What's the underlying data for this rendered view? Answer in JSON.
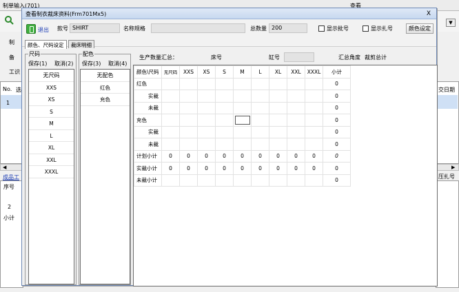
{
  "background": {
    "title": "制单输入(701)",
    "center_title": "查看",
    "left_labels": [
      "制",
      "备",
      "工识"
    ],
    "grid_col_no": "No.",
    "grid_col_partial": "选",
    "row_no": "1",
    "bottom_tab": "成品工",
    "bottom_col": "序号",
    "bottom_row": "2",
    "subtotal": "小计",
    "right_col_date": "交日期",
    "right_col_ticket": "压扎号"
  },
  "dialog": {
    "title": "查看制衣裁床资料(Frm701Mx5)",
    "close_label": "X",
    "toolbar": {
      "exit_label": "退出",
      "style_label": "款号",
      "style_value": "SHIRT",
      "name_label": "名称规格",
      "name_value": "",
      "total_label": "总数量",
      "total_value": "200",
      "show_batch_label": "显示批号",
      "show_ticket_label": "显示扎号",
      "color_settings_label": "颜色设定"
    },
    "tabs": [
      "颜色、尺码设定",
      "裁床明细"
    ],
    "size_panel": {
      "title": "尺码",
      "save_label": "保存(1)",
      "cancel_label": "取消(2)",
      "items": [
        "无尺码",
        "XXS",
        "XS",
        "S",
        "M",
        "L",
        "XL",
        "XXL",
        "XXXL"
      ]
    },
    "color_panel": {
      "title": "配色",
      "save_label": "保存(3)",
      "cancel_label": "取消(4)",
      "items": [
        "无配色",
        "红色",
        "充色"
      ]
    },
    "summary": {
      "production_label": "生产数量汇总：",
      "seq_label": "床号",
      "cylinder_label": "缸号",
      "cylinder_value": "",
      "angle_label": "汇总角度",
      "angle_value": "裁剪总计"
    },
    "matrix": {
      "corner": "颜色\\尺码",
      "columns": [
        "无尺码",
        "XXS",
        "XS",
        "S",
        "M",
        "L",
        "XL",
        "XXL",
        "XXXL"
      ],
      "total_col": "小计",
      "rows": [
        {
          "label": "红色",
          "indent": false,
          "values": [
            "",
            "",
            "",
            "",
            "",
            "",
            "",
            "",
            ""
          ],
          "total": "0"
        },
        {
          "label": "实裁",
          "indent": true,
          "values": [
            "",
            "",
            "",
            "",
            "",
            "",
            "",
            "",
            ""
          ],
          "total": "0"
        },
        {
          "label": "未裁",
          "indent": true,
          "values": [
            "",
            "",
            "",
            "",
            "",
            "",
            "",
            "",
            ""
          ],
          "total": "0"
        },
        {
          "label": "充色",
          "indent": false,
          "values": [
            "",
            "",
            "",
            "",
            "",
            "",
            "",
            "",
            ""
          ],
          "total": "0"
        },
        {
          "label": "实裁",
          "indent": true,
          "values": [
            "",
            "",
            "",
            "",
            "",
            "",
            "",
            "",
            ""
          ],
          "total": "0"
        },
        {
          "label": "未裁",
          "indent": true,
          "values": [
            "",
            "",
            "",
            "",
            "",
            "",
            "",
            "",
            ""
          ],
          "total": "0"
        },
        {
          "label": "计划小计",
          "indent": false,
          "values": [
            "0",
            "0",
            "0",
            "0",
            "0",
            "0",
            "0",
            "0",
            "0"
          ],
          "total": "0"
        },
        {
          "label": "实裁小计",
          "indent": false,
          "values": [
            "0",
            "0",
            "0",
            "0",
            "0",
            "0",
            "0",
            "0",
            "0"
          ],
          "total": "0"
        },
        {
          "label": "未裁小计",
          "indent": false,
          "values": [
            "",
            "",
            "",
            "",
            "",
            "",
            "",
            "",
            ""
          ],
          "total": "0"
        }
      ]
    }
  }
}
